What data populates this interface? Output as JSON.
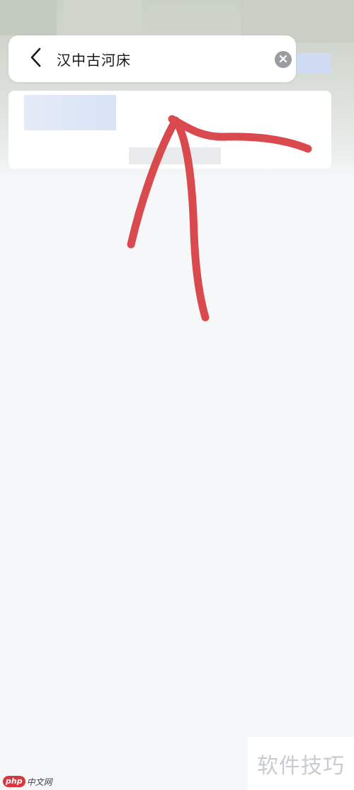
{
  "search": {
    "query": "汉中古河床"
  },
  "icons": {
    "back": "chevron-left-icon",
    "clear": "clear-circle-icon"
  },
  "annotation": {
    "color": "#d94a4f",
    "shape": "hand-drawn-arrow-up"
  },
  "watermarks": {
    "corner_text": "软件技巧",
    "site_logo": "php",
    "site_text": "中文网"
  }
}
